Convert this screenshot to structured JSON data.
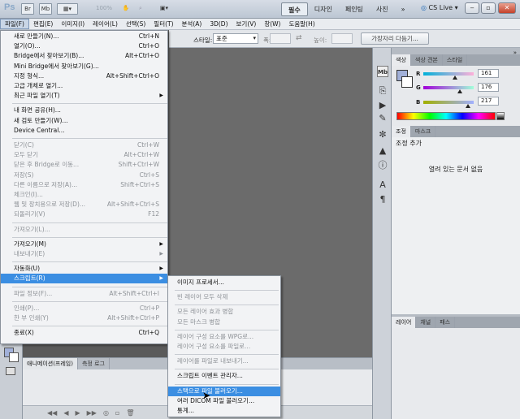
{
  "titlebar": {
    "logo": "Ps",
    "br_icon": "Br",
    "mb_icon": "Mb",
    "zoom": "100%",
    "workspaces": [
      "필수",
      "디자인",
      "페인팅",
      "사진"
    ],
    "more": "»",
    "cslive": "CS Live ▾",
    "min": "‒",
    "max": "▫",
    "close": "✕"
  },
  "menubar": [
    "파일(F)",
    "편집(E)",
    "이미지(I)",
    "레이어(L)",
    "선택(S)",
    "필터(T)",
    "분석(A)",
    "3D(D)",
    "보기(V)",
    "창(W)",
    "도움말(H)"
  ],
  "options": {
    "style_label": "스타일:",
    "style_value": "표준",
    "width_label": "폭:",
    "height_label": "높이:",
    "refine": "가장자리 다듬기..."
  },
  "file_menu": [
    {
      "label": "새로 만들기(N)...",
      "shortcut": "Ctrl+N",
      "state": "normal"
    },
    {
      "label": "열기(O)...",
      "shortcut": "Ctrl+O",
      "state": "normal"
    },
    {
      "label": "Bridge에서 찾아보기(B)...",
      "shortcut": "Alt+Ctrl+O",
      "state": "normal"
    },
    {
      "label": "Mini Bridge에서 찾아보기(G)...",
      "shortcut": "",
      "state": "normal"
    },
    {
      "label": "지정 형식...",
      "shortcut": "Alt+Shift+Ctrl+O",
      "state": "normal"
    },
    {
      "label": "고급 개체로 열기...",
      "shortcut": "",
      "state": "normal"
    },
    {
      "label": "최근 파일 열기(T)",
      "shortcut": "",
      "state": "submenu"
    },
    {
      "sep": true
    },
    {
      "label": "내 화면 공유(H)...",
      "shortcut": "",
      "state": "normal"
    },
    {
      "label": "새 검토 만들기(W)...",
      "shortcut": "",
      "state": "normal"
    },
    {
      "label": "Device Central...",
      "shortcut": "",
      "state": "normal"
    },
    {
      "sep": true
    },
    {
      "label": "닫기(C)",
      "shortcut": "Ctrl+W",
      "state": "disabled"
    },
    {
      "label": "모두 닫기",
      "shortcut": "Alt+Ctrl+W",
      "state": "disabled"
    },
    {
      "label": "닫은 후 Bridge로 이동...",
      "shortcut": "Shift+Ctrl+W",
      "state": "disabled"
    },
    {
      "label": "저장(S)",
      "shortcut": "Ctrl+S",
      "state": "disabled"
    },
    {
      "label": "다른 이름으로 저장(A)...",
      "shortcut": "Shift+Ctrl+S",
      "state": "disabled"
    },
    {
      "label": "체크인(I)...",
      "shortcut": "",
      "state": "disabled"
    },
    {
      "label": "웹 및 장치용으로 저장(D)...",
      "shortcut": "Alt+Shift+Ctrl+S",
      "state": "disabled"
    },
    {
      "label": "되돌리기(V)",
      "shortcut": "F12",
      "state": "disabled"
    },
    {
      "sep": true
    },
    {
      "label": "가져오기(L)...",
      "shortcut": "",
      "state": "disabled"
    },
    {
      "sep": true
    },
    {
      "label": "가져오기(M)",
      "shortcut": "",
      "state": "submenu"
    },
    {
      "label": "내보내기(E)",
      "shortcut": "",
      "state": "submenu-disabled"
    },
    {
      "sep": true
    },
    {
      "label": "자동화(U)",
      "shortcut": "",
      "state": "submenu"
    },
    {
      "label": "스크립트(R)",
      "shortcut": "",
      "state": "highlight"
    },
    {
      "sep": true
    },
    {
      "label": "파일 정보(F)...",
      "shortcut": "Alt+Shift+Ctrl+I",
      "state": "disabled"
    },
    {
      "sep": true
    },
    {
      "label": "인쇄(P)...",
      "shortcut": "Ctrl+P",
      "state": "disabled"
    },
    {
      "label": "한 부 인쇄(Y)",
      "shortcut": "Alt+Shift+Ctrl+P",
      "state": "disabled"
    },
    {
      "sep": true
    },
    {
      "label": "종료(X)",
      "shortcut": "Ctrl+Q",
      "state": "normal"
    }
  ],
  "scripts_menu": [
    {
      "label": "이미지 프로세서...",
      "state": "normal"
    },
    {
      "sep": true
    },
    {
      "label": "빈 레이어 모두 삭제",
      "state": "disabled"
    },
    {
      "sep": true
    },
    {
      "label": "모든 레이어 효과 병합",
      "state": "disabled"
    },
    {
      "label": "모든 마스크 병합",
      "state": "disabled"
    },
    {
      "sep": true
    },
    {
      "label": "레이어 구성 요소를 WPG로...",
      "state": "disabled"
    },
    {
      "label": "레이어 구성 요소를 파일로...",
      "state": "disabled"
    },
    {
      "sep": true
    },
    {
      "label": "레이어를 파일로 내보내기...",
      "state": "disabled"
    },
    {
      "sep": true
    },
    {
      "label": "스크립트 이벤트 관리자...",
      "state": "normal"
    },
    {
      "sep": true
    },
    {
      "label": "스택으로 파일 불러오기...",
      "state": "highlight"
    },
    {
      "label": "여러 DICOM 파일 불러오기...",
      "state": "normal"
    },
    {
      "label": "통계...",
      "state": "normal"
    }
  ],
  "anim_panel": {
    "tabs": [
      "애니메이션(프레임)",
      "측정 로그"
    ]
  },
  "color_panel": {
    "tabs": [
      "색상",
      "색상 견본",
      "스타일"
    ],
    "r": "161",
    "g": "176",
    "b": "217",
    "r_label": "R",
    "g_label": "G",
    "b_label": "B",
    "fg_color": "#a1b0d9"
  },
  "adjust_panel": {
    "tabs": [
      "조정",
      "마스크"
    ],
    "title": "조정 추가",
    "empty": "열려 있는 문서 없음"
  },
  "layers_panel": {
    "tabs": [
      "레이어",
      "채널",
      "패스"
    ]
  }
}
